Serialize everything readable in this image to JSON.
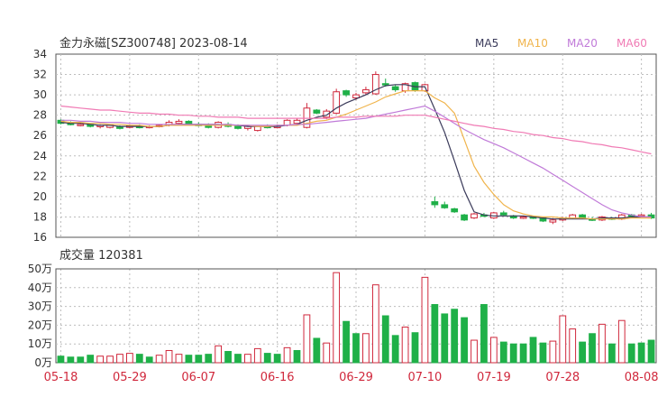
{
  "header": {
    "title": "金力永磁[SZ300748] 2023-08-14"
  },
  "legend": [
    {
      "label": "MA5",
      "color": "#3a3a5a"
    },
    {
      "label": "MA10",
      "color": "#f0b44c"
    },
    {
      "label": "MA20",
      "color": "#c07ad8"
    },
    {
      "label": "MA60",
      "color": "#f07ab4"
    }
  ],
  "volume_header": {
    "label": "成交量 120381"
  },
  "colors": {
    "up": "#d0283c",
    "down": "#1fb048",
    "grid": "#bdbdbd",
    "axis": "#555555"
  },
  "chart_data": [
    {
      "type": "candlestick",
      "title": "金力永磁[SZ300748] 2023-08-14",
      "ylim": [
        16,
        34
      ],
      "yticks": [
        16,
        18,
        20,
        22,
        24,
        26,
        28,
        30,
        32,
        34
      ],
      "xticks": [
        "05-18",
        "05-29",
        "06-07",
        "06-16",
        "06-29",
        "07-10",
        "07-19",
        "07-28",
        "08-08"
      ],
      "candles": [
        [
          27.5,
          27.6,
          27.1,
          27.2
        ],
        [
          27.2,
          27.4,
          27.0,
          27.1
        ],
        [
          27.1,
          27.3,
          26.9,
          27.1
        ],
        [
          27.1,
          27.2,
          26.8,
          26.9
        ],
        [
          26.9,
          27.1,
          26.7,
          27.0
        ],
        [
          26.8,
          27.1,
          26.7,
          27.0
        ],
        [
          26.9,
          27.0,
          26.6,
          26.7
        ],
        [
          26.8,
          27.1,
          26.7,
          27.0
        ],
        [
          26.9,
          27.1,
          26.7,
          26.8
        ],
        [
          26.8,
          27.0,
          26.7,
          26.9
        ],
        [
          26.9,
          27.1,
          26.8,
          27.0
        ],
        [
          27.0,
          27.5,
          26.9,
          27.3
        ],
        [
          27.2,
          27.6,
          27.1,
          27.4
        ],
        [
          27.4,
          27.5,
          27.0,
          27.1
        ],
        [
          27.1,
          27.3,
          26.9,
          27.0
        ],
        [
          27.0,
          27.2,
          26.7,
          26.8
        ],
        [
          26.8,
          27.4,
          26.7,
          27.3
        ],
        [
          27.1,
          27.3,
          26.8,
          26.9
        ],
        [
          26.9,
          27.1,
          26.6,
          26.7
        ],
        [
          26.7,
          27.0,
          26.5,
          26.9
        ],
        [
          26.5,
          27.0,
          26.4,
          26.9
        ],
        [
          26.9,
          27.1,
          26.7,
          26.8
        ],
        [
          26.8,
          27.1,
          26.7,
          26.9
        ],
        [
          27.0,
          27.6,
          26.9,
          27.5
        ],
        [
          27.2,
          27.7,
          27.0,
          27.5
        ],
        [
          26.8,
          29.2,
          26.7,
          28.7
        ],
        [
          28.5,
          28.6,
          28.1,
          28.2
        ],
        [
          27.8,
          28.6,
          27.6,
          28.4
        ],
        [
          28.2,
          30.6,
          28.1,
          30.3
        ],
        [
          30.4,
          30.5,
          29.8,
          30.0
        ],
        [
          29.7,
          30.2,
          29.5,
          30.0
        ],
        [
          30.2,
          30.8,
          30.0,
          30.5
        ],
        [
          30.1,
          32.3,
          30.0,
          32.0
        ],
        [
          31.1,
          31.6,
          30.8,
          31.0
        ],
        [
          30.8,
          31.0,
          30.3,
          30.5
        ],
        [
          30.4,
          31.2,
          30.2,
          31.1
        ],
        [
          31.2,
          31.3,
          30.3,
          30.5
        ],
        [
          30.4,
          31.1,
          30.3,
          31.0
        ],
        [
          19.5,
          20.0,
          18.9,
          19.2
        ],
        [
          19.2,
          19.5,
          18.8,
          18.9
        ],
        [
          18.8,
          18.9,
          18.4,
          18.5
        ],
        [
          18.2,
          18.3,
          17.6,
          17.7
        ],
        [
          17.9,
          18.4,
          17.8,
          18.3
        ],
        [
          18.2,
          18.4,
          18.0,
          18.1
        ],
        [
          17.9,
          18.5,
          17.8,
          18.4
        ],
        [
          18.4,
          18.6,
          18.1,
          18.2
        ],
        [
          18.1,
          18.2,
          17.8,
          17.9
        ],
        [
          17.9,
          18.1,
          17.8,
          18.0
        ],
        [
          18.0,
          18.1,
          17.8,
          17.9
        ],
        [
          17.9,
          18.0,
          17.5,
          17.6
        ],
        [
          17.5,
          17.9,
          17.3,
          17.7
        ],
        [
          17.7,
          18.0,
          17.6,
          17.9
        ],
        [
          17.9,
          18.3,
          17.8,
          18.2
        ],
        [
          18.2,
          18.3,
          17.8,
          17.9
        ],
        [
          17.8,
          18.0,
          17.6,
          17.7
        ],
        [
          17.7,
          18.1,
          17.6,
          18.0
        ],
        [
          17.9,
          18.0,
          17.7,
          17.8
        ],
        [
          17.8,
          18.3,
          17.7,
          18.2
        ],
        [
          18.2,
          18.3,
          18.0,
          18.1
        ],
        [
          18.1,
          18.3,
          18.0,
          18.2
        ],
        [
          18.2,
          18.4,
          17.8,
          17.9
        ]
      ],
      "series": [
        {
          "name": "MA5",
          "values": [
            27.3,
            27.2,
            27.2,
            27.1,
            27.0,
            27.0,
            26.9,
            26.9,
            26.9,
            26.9,
            26.9,
            27.0,
            27.1,
            27.1,
            27.1,
            27.1,
            27.1,
            27.0,
            27.0,
            26.9,
            26.9,
            26.9,
            26.9,
            27.0,
            27.1,
            27.5,
            27.8,
            28.0,
            28.7,
            29.2,
            29.6,
            30.0,
            30.5,
            30.9,
            31.0,
            31.0,
            30.8,
            30.8,
            28.6,
            26.3,
            23.5,
            20.6,
            18.5,
            18.2,
            18.1,
            18.1,
            18.1,
            18.1,
            18.0,
            17.9,
            17.8,
            17.8,
            17.8,
            17.8,
            17.8,
            17.9,
            17.9,
            17.9,
            18.0,
            18.0,
            18.0
          ]
        },
        {
          "name": "MA10",
          "values": [
            27.4,
            27.3,
            27.3,
            27.2,
            27.2,
            27.1,
            27.1,
            27.0,
            27.0,
            26.9,
            26.9,
            27.0,
            27.0,
            27.0,
            27.0,
            27.0,
            27.0,
            27.0,
            27.0,
            27.0,
            26.9,
            26.9,
            27.0,
            27.0,
            27.0,
            27.2,
            27.4,
            27.5,
            27.8,
            28.1,
            28.5,
            28.9,
            29.3,
            29.8,
            30.1,
            30.4,
            30.4,
            30.4,
            29.7,
            29.2,
            28.2,
            25.6,
            23.0,
            21.4,
            20.2,
            19.2,
            18.6,
            18.3,
            18.1,
            18.0,
            18.0,
            17.9,
            17.9,
            17.9,
            17.8,
            17.8,
            17.8,
            17.8,
            17.9,
            17.9,
            17.9
          ]
        },
        {
          "name": "MA20",
          "values": [
            27.5,
            27.5,
            27.4,
            27.4,
            27.3,
            27.3,
            27.3,
            27.2,
            27.2,
            27.1,
            27.1,
            27.1,
            27.1,
            27.1,
            27.1,
            27.1,
            27.1,
            27.1,
            27.0,
            27.0,
            27.0,
            27.0,
            27.0,
            27.0,
            27.1,
            27.1,
            27.2,
            27.3,
            27.4,
            27.5,
            27.6,
            27.7,
            27.9,
            28.1,
            28.3,
            28.5,
            28.7,
            28.9,
            28.4,
            27.8,
            27.2,
            26.6,
            26.1,
            25.6,
            25.2,
            24.8,
            24.3,
            23.8,
            23.3,
            22.8,
            22.2,
            21.6,
            21.0,
            20.4,
            19.8,
            19.2,
            18.7,
            18.4,
            18.2,
            18.0,
            18.0
          ]
        },
        {
          "name": "MA60",
          "values": [
            28.9,
            28.8,
            28.7,
            28.6,
            28.5,
            28.5,
            28.4,
            28.3,
            28.2,
            28.2,
            28.1,
            28.1,
            28.0,
            28.0,
            27.9,
            27.9,
            27.8,
            27.8,
            27.8,
            27.7,
            27.7,
            27.7,
            27.7,
            27.7,
            27.7,
            27.7,
            27.7,
            27.7,
            27.8,
            27.8,
            27.8,
            27.9,
            27.9,
            27.9,
            27.9,
            28.0,
            28.0,
            28.0,
            27.8,
            27.6,
            27.4,
            27.2,
            27.0,
            26.9,
            26.7,
            26.6,
            26.4,
            26.3,
            26.1,
            26.0,
            25.8,
            25.7,
            25.5,
            25.4,
            25.2,
            25.1,
            24.9,
            24.8,
            24.6,
            24.4,
            24.2
          ]
        }
      ]
    },
    {
      "type": "bar",
      "title": "成交量 120381",
      "ylim": [
        0,
        50
      ],
      "yticks": [
        "0万",
        "10万",
        "20万",
        "30万",
        "40万",
        "50万"
      ],
      "values": [
        3.5,
        3,
        3,
        4,
        3.5,
        3.5,
        4.5,
        5,
        4.5,
        3,
        4,
        6.5,
        4.5,
        4,
        4,
        4.5,
        9,
        6,
        4.5,
        4.5,
        7.5,
        5,
        4.5,
        8,
        6.5,
        25.5,
        13,
        10.5,
        48,
        22,
        15.5,
        15.5,
        41.5,
        25,
        14.5,
        19,
        16,
        45.5,
        31,
        26,
        28.5,
        24,
        12,
        31,
        13.5,
        11,
        10,
        10,
        13.5,
        10.5,
        11.5,
        25,
        18,
        11,
        15.5,
        20.5,
        10,
        22.5,
        10,
        10.5,
        12
      ],
      "up": [
        0,
        0,
        0,
        0,
        1,
        1,
        1,
        1,
        0,
        0,
        1,
        1,
        1,
        0,
        0,
        0,
        1,
        0,
        0,
        1,
        1,
        0,
        0,
        1,
        0,
        1,
        0,
        1,
        1,
        0,
        0,
        1,
        1,
        0,
        0,
        1,
        0,
        1,
        0,
        0,
        0,
        0,
        1,
        0,
        1,
        0,
        0,
        0,
        0,
        0,
        1,
        1,
        1,
        0,
        0,
        1,
        0,
        1,
        0,
        0,
        0
      ]
    }
  ]
}
